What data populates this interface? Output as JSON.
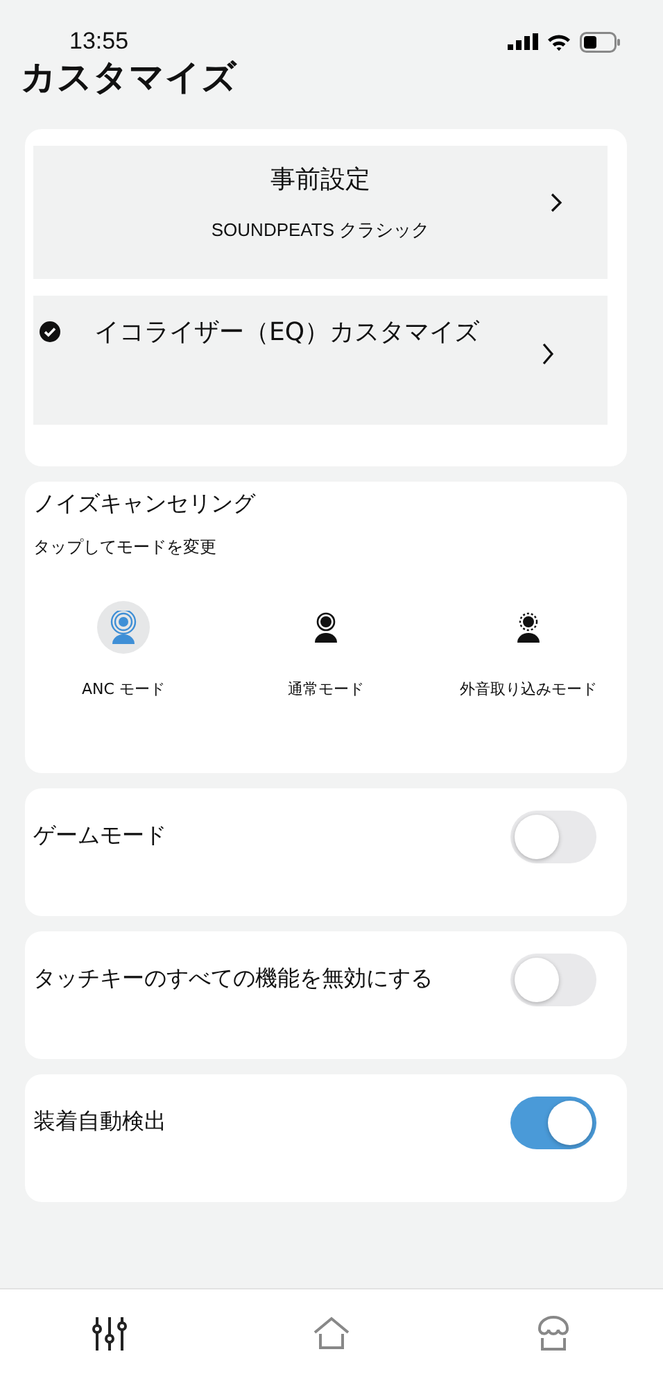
{
  "status_bar": {
    "time": "13:55"
  },
  "title": "カスタマイズ",
  "preset": {
    "title": "事前設定",
    "value": "SOUNDPEATS クラシック"
  },
  "eq": {
    "label": "イコライザー（EQ）カスタマイズ",
    "checked": true
  },
  "noise_cancelling": {
    "title": "ノイズキャンセリング",
    "hint": "タップしてモードを変更",
    "modes": [
      {
        "kind": "anc",
        "label": "ANC モード",
        "selected": true
      },
      {
        "kind": "normal",
        "label": "通常モード",
        "selected": false
      },
      {
        "kind": "ambient",
        "label": "外音取り込みモード",
        "selected": false
      }
    ]
  },
  "toggles": [
    {
      "label": "ゲームモード",
      "on": false
    },
    {
      "label": "タッチキーのすべての機能を無効にする",
      "on": false
    },
    {
      "label": "装着自動検出",
      "on": true
    }
  ],
  "tabs": [
    {
      "kind": "equalizer",
      "selected": true
    },
    {
      "kind": "home",
      "selected": false
    },
    {
      "kind": "store",
      "selected": false
    }
  ]
}
